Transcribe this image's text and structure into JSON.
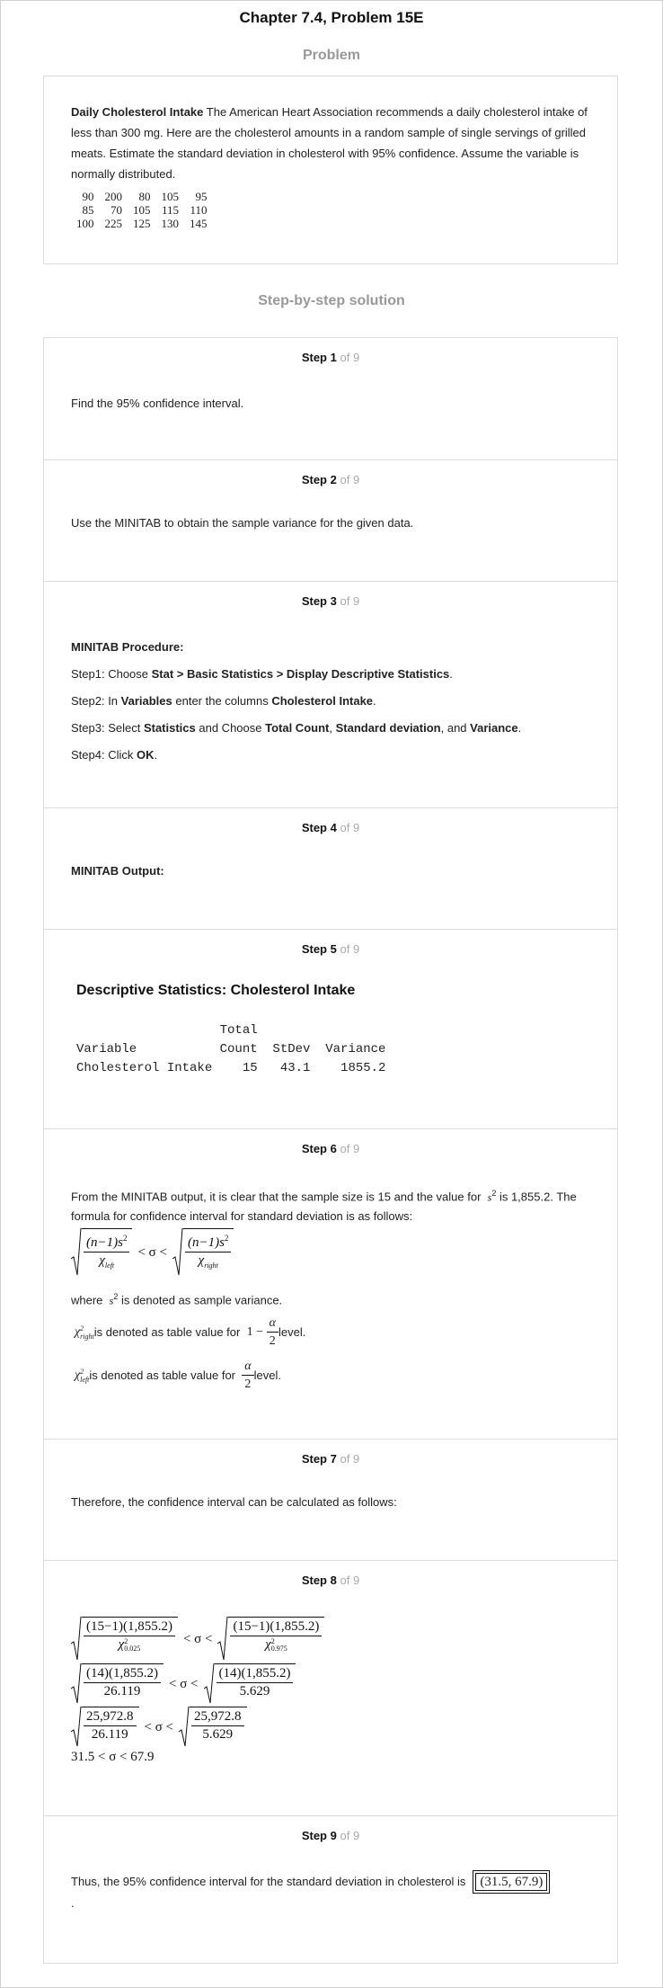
{
  "title": "Chapter 7.4, Problem 15E",
  "problem_heading": "Problem",
  "problem": {
    "bold_lead": "Daily Cholesterol Intake",
    "text": " The American Heart Association recommends a daily cholesterol intake of less than 300 mg. Here are the cholesterol amounts in a random sample of single servings of grilled meats. Estimate the standard deviation in cholesterol with 95% confidence. Assume the variable is normally distributed.",
    "table": [
      [
        "90",
        "200",
        "80",
        "105",
        "95"
      ],
      [
        "85",
        "70",
        "105",
        "115",
        "110"
      ],
      [
        "100",
        "225",
        "125",
        "130",
        "145"
      ]
    ]
  },
  "solution_heading": "Step-by-step solution",
  "step_word": "Step",
  "of_text": "of 9",
  "steps": [
    {
      "n": "1",
      "text": "Find the 95% confidence interval."
    },
    {
      "n": "2",
      "text": "Use the MINITAB to obtain the sample variance for the given data."
    },
    {
      "n": "3",
      "proc_title": "MINITAB Procedure:",
      "s1_a": "Step1: Choose ",
      "s1_b": "Stat > Basic Statistics > Display Descriptive Statistics",
      "s1_c": ".",
      "s2_a": "Step2: In ",
      "s2_b": "Variables",
      "s2_c": " enter the columns ",
      "s2_d": "Cholesterol Intake",
      "s2_e": ".",
      "s3_a": "Step3: Select ",
      "s3_b": "Statistics",
      "s3_c": " and Choose ",
      "s3_d": "Total Count",
      "s3_e": ", ",
      "s3_f": "Standard deviation",
      "s3_g": ", and ",
      "s3_h": "Variance",
      "s3_i": ".",
      "s4_a": "Step4: Click ",
      "s4_b": "OK",
      "s4_c": "."
    },
    {
      "n": "4",
      "text": "MINITAB Output:"
    },
    {
      "n": "5",
      "ds_title": "Descriptive Statistics: Cholesterol Intake",
      "out_line1": "                   Total",
      "out_line2": "Variable           Count  StDev  Variance",
      "out_line3": "Cholesterol Intake    15   43.1    1855.2"
    },
    {
      "n": "6",
      "p1_a": "From the MINITAB output, it is clear that the sample size is 15 and the value for",
      "p1_var": "s",
      "p1_b": " is 1,855.2. The formula for confidence interval for standard deviation is as follows:",
      "num": "(n−1)s",
      "chi": "χ",
      "left_sub": "left",
      "right_sub": "right",
      "lt": "< σ <",
      "where_a": "where",
      "where_b": " is denoted as sample variance.",
      "right_desc": " is denoted as table value for",
      "right_expr": "1 −",
      "alpha": "α",
      "two": "2",
      "level": " level.",
      "left_desc": " is denoted as table value for"
    },
    {
      "n": "7",
      "text": "Therefore, the confidence interval can be calculated as follows:"
    },
    {
      "n": "8",
      "r1_num": "(15−1)(1,855.2)",
      "r1_den_l": "0.025",
      "r1_den_r": "0.975",
      "r2_num": "(14)(1,855.2)",
      "r2_den_l": "26.119",
      "r2_den_r": "5.629",
      "r3_num": "25,972.8",
      "r3_den_l": "26.119",
      "r3_den_r": "5.629",
      "r4": "31.5 < σ < 67.9"
    },
    {
      "n": "9",
      "text": "Thus, the 95% confidence interval for the standard deviation in cholesterol is",
      "answer": "(31.5, 67.9)",
      "trail": "."
    }
  ]
}
